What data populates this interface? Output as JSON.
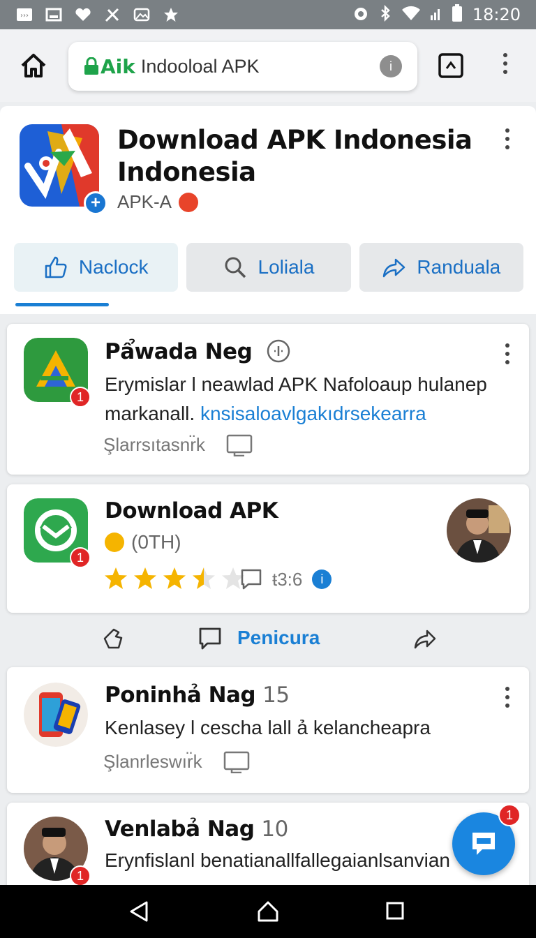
{
  "status_bar": {
    "time": "18:20"
  },
  "browser": {
    "url_brand": "Aik",
    "url_text": "Indooloal APK"
  },
  "app": {
    "title": "Download APK Indonesia Indonesia",
    "subtitle": "APK-A",
    "tabs": [
      {
        "label": "Naclock",
        "icon": "thumbs-up-icon"
      },
      {
        "label": "Loliala",
        "icon": "search-icon"
      },
      {
        "label": "Randuala",
        "icon": "share-icon"
      }
    ]
  },
  "feed": {
    "post1": {
      "title": "Pẩwada Neg",
      "body_text": "Erymislar l neawlad APK Nafoloaup hulanep markanall.",
      "body_link": "knsisaloavlgakıdrsekearra",
      "meta": "Şlarrsıtasnr̈k",
      "badge": "1"
    },
    "post2": {
      "title": "Download APK",
      "sub": "(0TH)",
      "rating": 3.5,
      "comment_count": "ŧ3:6",
      "badge": "1"
    },
    "actions": {
      "comment_label": "Penicura"
    },
    "post3": {
      "title": "Poninhả Nag",
      "number": "15",
      "body_text": "Kenlasey l cescha lall ả kelancheapra",
      "meta": "Şlanrleswır̈k"
    },
    "post4": {
      "title": "Venlabả Nag",
      "number": "10",
      "body_text": "Erynfislanl benatianallfallegaianlsanvian",
      "badge": "1"
    }
  },
  "fab": {
    "badge": "1"
  },
  "colors": {
    "accent": "#1a7fd4",
    "badge": "#e02626",
    "brand_green": "#1ea34a"
  }
}
